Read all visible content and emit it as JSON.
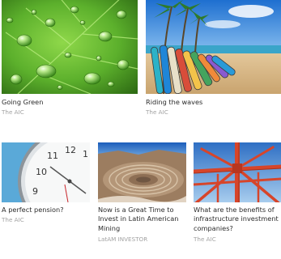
{
  "articles": [
    {
      "title": "Going Green",
      "source": "The AIC",
      "image": "water-drops-on-leaf"
    },
    {
      "title": "Riding the waves",
      "source": "The AIC",
      "image": "surfboards-on-beach"
    },
    {
      "title": "A perfect pension?",
      "source": "The AIC",
      "image": "wall-clock"
    },
    {
      "title": "Now is a Great Time to Invest in Latin American Mining",
      "source": "LatAM INVESTOR",
      "image": "open-pit-mine"
    },
    {
      "title": "What are the benefits of infrastructure investment companies?",
      "source": "The AIC",
      "image": "red-steel-structure"
    }
  ]
}
